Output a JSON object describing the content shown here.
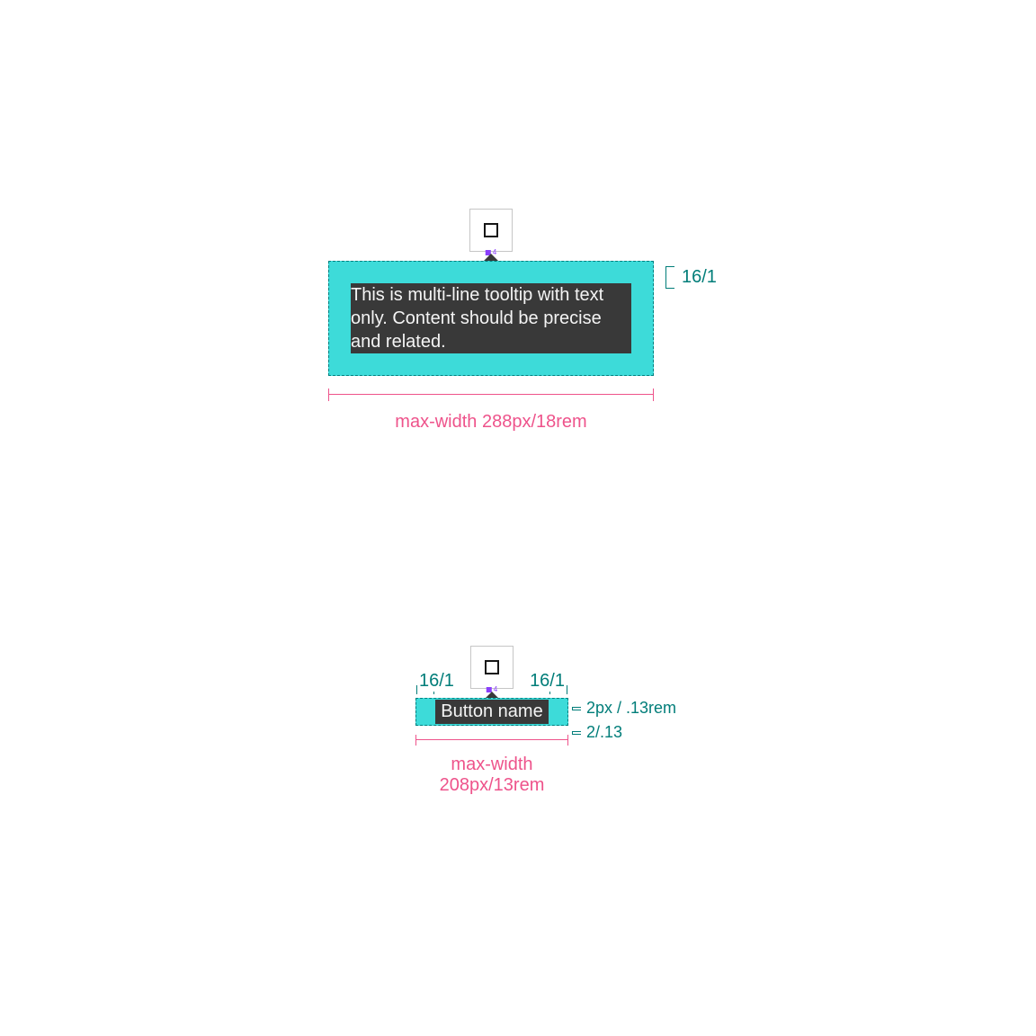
{
  "example1": {
    "tooltip_text": "This is multi-line tooltip with text only. Content should be precise and related.",
    "padding_label": "16/1",
    "width_label": "max-width 288px/18rem",
    "handle_value": "4"
  },
  "example2": {
    "tooltip_text": "Button name",
    "hpad_left_label": "16/1",
    "hpad_right_label": "16/1",
    "vpad_label_1": "2px / .13rem",
    "vpad_label_2": "2/.13",
    "width_label": "max-width 208px/13rem",
    "handle_value": "4"
  }
}
